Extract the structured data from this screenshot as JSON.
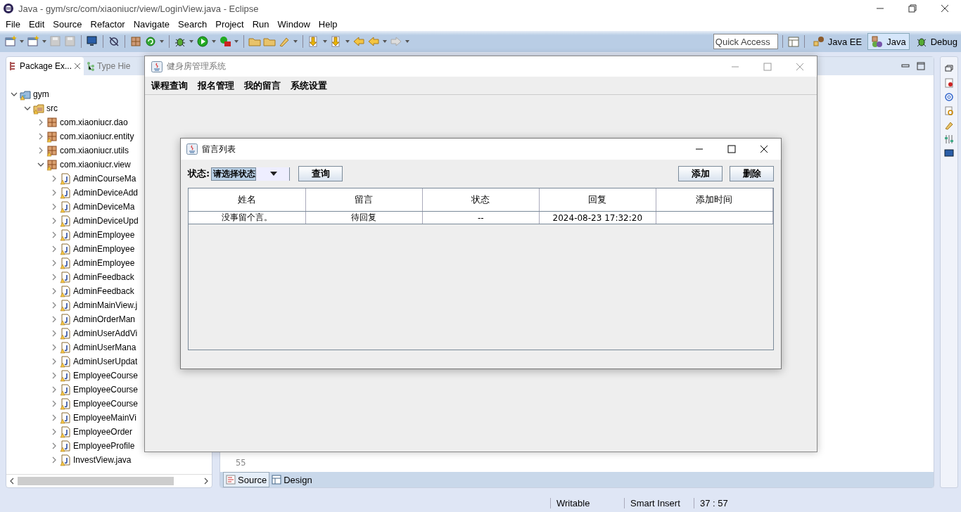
{
  "window": {
    "title": "Java - gym/src/com/xiaoniucr/view/LoginView.java - Eclipse"
  },
  "menu": [
    "File",
    "Edit",
    "Source",
    "Refactor",
    "Navigate",
    "Search",
    "Project",
    "Run",
    "Window",
    "Help"
  ],
  "quick_access": {
    "placeholder": "Quick Access"
  },
  "perspectives": [
    {
      "label": "Java EE",
      "selected": false
    },
    {
      "label": "Java",
      "selected": true
    },
    {
      "label": "Debug",
      "selected": false
    }
  ],
  "package_explorer": {
    "tabs": [
      {
        "label": "Package Ex...",
        "selected": true
      },
      {
        "label": "Type Hie",
        "selected": false
      }
    ],
    "tree": [
      {
        "label": "gym",
        "kind": "project",
        "expanded": true,
        "children": [
          {
            "label": "src",
            "kind": "source",
            "expanded": true,
            "children": [
              {
                "label": "com.xiaoniucr.dao",
                "kind": "package",
                "expanded": false
              },
              {
                "label": "com.xiaoniucr.entity",
                "kind": "package",
                "expanded": false
              },
              {
                "label": "com.xiaoniucr.utils",
                "kind": "package",
                "expanded": false
              },
              {
                "label": "com.xiaoniucr.view",
                "kind": "package",
                "expanded": true,
                "children": [
                  {
                    "label": "AdminCourseMa",
                    "kind": "file",
                    "expanded": false
                  },
                  {
                    "label": "AdminDeviceAdd",
                    "kind": "file",
                    "expanded": false
                  },
                  {
                    "label": "AdminDeviceMa",
                    "kind": "file",
                    "expanded": false
                  },
                  {
                    "label": "AdminDeviceUpd",
                    "kind": "file",
                    "expanded": false
                  },
                  {
                    "label": "AdminEmployee",
                    "kind": "file",
                    "expanded": false
                  },
                  {
                    "label": "AdminEmployee",
                    "kind": "file",
                    "expanded": false
                  },
                  {
                    "label": "AdminEmployee",
                    "kind": "file",
                    "expanded": false
                  },
                  {
                    "label": "AdminFeedback",
                    "kind": "file",
                    "expanded": false
                  },
                  {
                    "label": "AdminFeedback",
                    "kind": "file",
                    "expanded": false
                  },
                  {
                    "label": "AdminMainView.j",
                    "kind": "file",
                    "expanded": false
                  },
                  {
                    "label": "AdminOrderMan",
                    "kind": "file",
                    "expanded": false
                  },
                  {
                    "label": "AdminUserAddVi",
                    "kind": "file",
                    "expanded": false
                  },
                  {
                    "label": "AdminUserMana",
                    "kind": "file",
                    "expanded": false
                  },
                  {
                    "label": "AdminUserUpdat",
                    "kind": "file",
                    "expanded": false
                  },
                  {
                    "label": "EmployeeCourse",
                    "kind": "file",
                    "expanded": false
                  },
                  {
                    "label": "EmployeeCourse",
                    "kind": "file",
                    "expanded": false
                  },
                  {
                    "label": "EmployeeCourse",
                    "kind": "file",
                    "expanded": false
                  },
                  {
                    "label": "EmployeeMainVi",
                    "kind": "file",
                    "expanded": false
                  },
                  {
                    "label": "EmployeeOrder",
                    "kind": "file",
                    "expanded": false
                  },
                  {
                    "label": "EmployeeProfile",
                    "kind": "file",
                    "expanded": false
                  },
                  {
                    "label": "InvestView.java",
                    "kind": "file",
                    "expanded": false
                  }
                ]
              }
            ]
          }
        ]
      }
    ]
  },
  "editor": {
    "line_number": "55",
    "tabs": [
      {
        "label": "Source",
        "selected": true
      },
      {
        "label": "Design",
        "selected": false
      }
    ]
  },
  "status_bar": [
    "Writable",
    "Smart Insert",
    "37 : 57"
  ],
  "app_frame": {
    "title": "健身房管理系统",
    "menu": [
      "课程查询",
      "报名管理",
      "我的留言",
      "系统设置"
    ]
  },
  "dialog": {
    "title": "留言列表",
    "filter_label": "状态:",
    "status_select": {
      "value": "请选择状态"
    },
    "search_button": "查询",
    "action_buttons": [
      "添加",
      "删除"
    ],
    "table": {
      "columns": [
        "姓名",
        "留言",
        "状态",
        "回复",
        "添加时间"
      ],
      "rows": [
        [
          "没事留个言。",
          "待回复",
          "--",
          "2024-08-23 17:32:20"
        ]
      ]
    }
  }
}
